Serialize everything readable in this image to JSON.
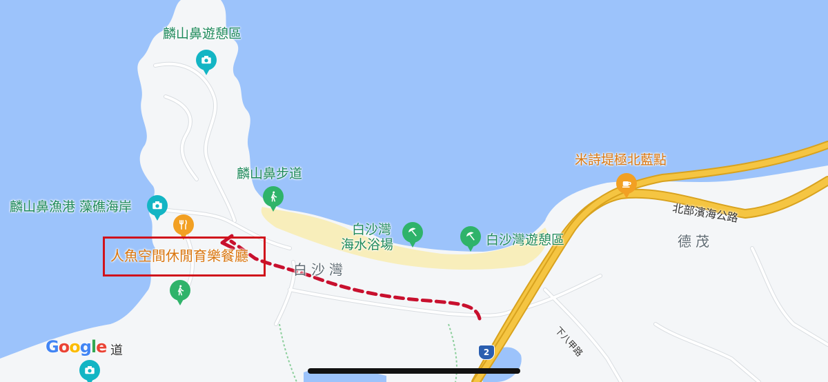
{
  "colors": {
    "water": "#9cc3fb",
    "land": "#f4f6f8",
    "beach": "#f8eebb",
    "highway": "#f5c542",
    "route_marker": "#c8102e",
    "highlight_box": "#d0121b"
  },
  "places": {
    "linshanbi_rest_area": {
      "name": "麟山鼻遊憩區",
      "icon": "camera-icon"
    },
    "linshanbi_trail": {
      "name": "麟山鼻步道",
      "icon": "hiking-icon"
    },
    "baishawan_beach": {
      "name_line1": "白沙灣",
      "name_line2": "海水浴場",
      "icon": "beach-umbrella-icon"
    },
    "baishawan_rest_area": {
      "name": "白沙灣遊憩區",
      "icon": "beach-umbrella-icon"
    },
    "mishiti_cafe": {
      "name": "米詩堤極北藍點",
      "icon": "coffee-cup-icon"
    },
    "fishing_port": {
      "name": "麟山鼻漁港 藻礁海岸",
      "icon": "camera-icon"
    },
    "mermaid_restaurant": {
      "name": "人魚空間休閒育樂餐廳",
      "icon": "fork-knife-icon"
    },
    "lower_hike": {
      "icon": "hiking-icon"
    },
    "bottom_spot": {
      "icon": "camera-icon"
    }
  },
  "area_labels": {
    "baishawan": "白沙灣",
    "demao": "德茂"
  },
  "roads": {
    "north_coast_highway": "北部濱海公路",
    "xiabajia_road": "下八甲路",
    "bottom_road_suffix": "道",
    "route_shield": "2"
  },
  "branding": {
    "google": [
      "G",
      "o",
      "o",
      "g",
      "l",
      "e"
    ],
    "google_colors": [
      "#4285F4",
      "#EA4335",
      "#FBBC05",
      "#4285F4",
      "#34A853",
      "#EA4335"
    ]
  }
}
